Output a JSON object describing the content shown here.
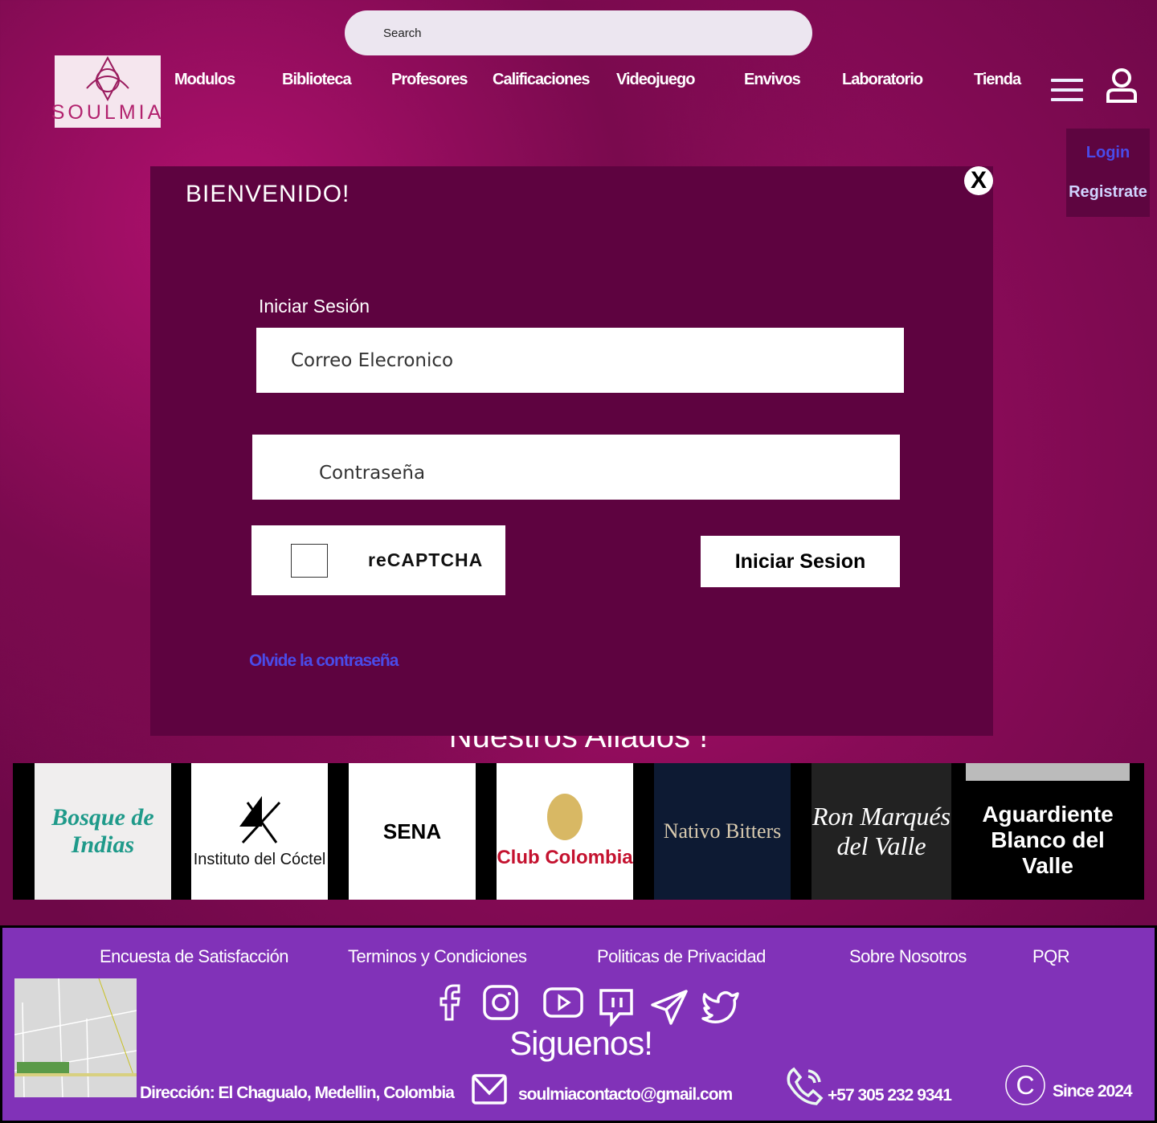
{
  "header": {
    "search_placeholder": "Search",
    "logo_text": "SOULMIA",
    "nav": [
      "Modulos",
      "Biblioteca",
      "Profesores",
      "Calificaciones",
      "Videojuego",
      "Envivos",
      "Laboratorio",
      "Tienda"
    ],
    "auth_menu": {
      "login": "Login",
      "register": "Registrate"
    }
  },
  "modal": {
    "title": "BIENVENIDO!",
    "close": "X",
    "subtitle": "Iniciar Sesión",
    "email_placeholder": "Correo Elecronico",
    "password_placeholder": "Contraseña",
    "captcha": "reCAPTCHA",
    "submit": "Iniciar Sesion",
    "forgot": "Olvide la contraseña"
  },
  "allies": {
    "title": "Nuestros Aliados !",
    "logos": [
      "Bosque de Indias",
      "Instituto del Cóctel",
      "SENA",
      "Club Colombia",
      "Nativo Bitters",
      "Ron Marqués del Valle",
      "Aguardiente Blanco del Valle"
    ]
  },
  "footer": {
    "links": [
      "Encuesta de Satisfacción",
      "Terminos y Condiciones",
      "Politicas de Privacidad",
      "Sobre Nosotros",
      "PQR"
    ],
    "social": [
      "facebook",
      "instagram",
      "youtube",
      "twitch",
      "telegram",
      "twitter"
    ],
    "follow": "Siguenos!",
    "address": "Dirección: El Chagualo, Medellin, Colombia",
    "email": "soulmiacontacto@gmail.com",
    "phone": "+57 305 232 9341",
    "since": "Since 2024"
  },
  "colors": {
    "background": "#a0106a",
    "modal": "#5e0340",
    "footer": "#8132b8",
    "link": "#4a4be8"
  }
}
